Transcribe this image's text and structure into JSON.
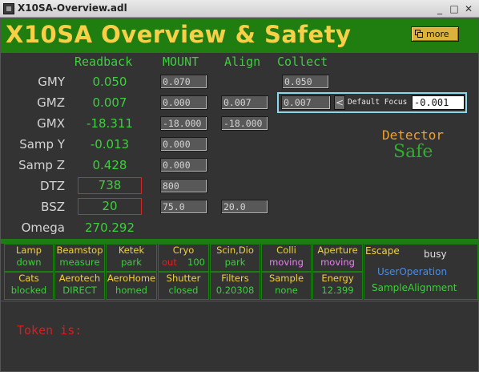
{
  "window": {
    "title": "X10SA-Overview.adl",
    "btn_minimize": "_",
    "btn_restore": "□",
    "btn_close": "✕"
  },
  "header": {
    "title": "X10SA Overview & Safety",
    "more_label": "more"
  },
  "columns": {
    "readback": "Readback",
    "mount": "MOUNT",
    "align": "Align",
    "collect": "Collect"
  },
  "rows": {
    "gmy": {
      "label": "GMY",
      "readback": "0.050",
      "mount": "0.070",
      "collect": "0.050"
    },
    "gmz": {
      "label": "GMZ",
      "readback": "0.007",
      "mount": "0.000",
      "align": "0.007",
      "collect": "0.007"
    },
    "gmx": {
      "label": "GMX",
      "readback": "-18.311",
      "mount": "-18.000",
      "align": "-18.000"
    },
    "sampy": {
      "label": "Samp Y",
      "readback": "-0.013",
      "mount": "0.000"
    },
    "sampz": {
      "label": "Samp Z",
      "readback": "0.428",
      "mount": "0.000"
    },
    "dtz": {
      "label": "DTZ",
      "readback": "738",
      "mount": "800"
    },
    "bsz": {
      "label": "BSZ",
      "readback": "20",
      "mount": "75.0",
      "align": "20.0"
    },
    "omega": {
      "label": "Omega",
      "readback": "270.292"
    }
  },
  "focus": {
    "arrow": "<",
    "label": "Default Focus",
    "value": "-0.001"
  },
  "detector": {
    "label": "Detector",
    "state": "Safe"
  },
  "status_row1": [
    {
      "name": "Lamp",
      "state": "down"
    },
    {
      "name": "Beamstop",
      "state": "measure"
    },
    {
      "name": "Ketek",
      "state": "park"
    },
    {
      "name": "Cryo",
      "state": "out",
      "extra": "100"
    },
    {
      "name": "Scin,Dio",
      "state": "park"
    },
    {
      "name": "Colli",
      "state": "moving"
    },
    {
      "name": "Aperture",
      "state": "moving"
    }
  ],
  "status_row2": [
    {
      "name": "Cats",
      "state": "blocked"
    },
    {
      "name": "Aerotech",
      "state": "DIRECT"
    },
    {
      "name": "AeroHome",
      "state": "homed"
    },
    {
      "name": "Shutter",
      "state": "closed"
    },
    {
      "name": "Filters",
      "state": "0.20308"
    },
    {
      "name": "Sample",
      "state": "none"
    },
    {
      "name": "Energy",
      "state": "12.399"
    }
  ],
  "escape": {
    "label": "Escape",
    "status": "busy",
    "user": "UserOperation",
    "mode": "SampleAlignment"
  },
  "token": {
    "label": "Token is:"
  },
  "colors": {
    "header_bg": "#207d10",
    "title": "#f8d048",
    "value_green": "#3ecf3e",
    "panel_bg": "#333333",
    "alarm": "#d62828"
  }
}
